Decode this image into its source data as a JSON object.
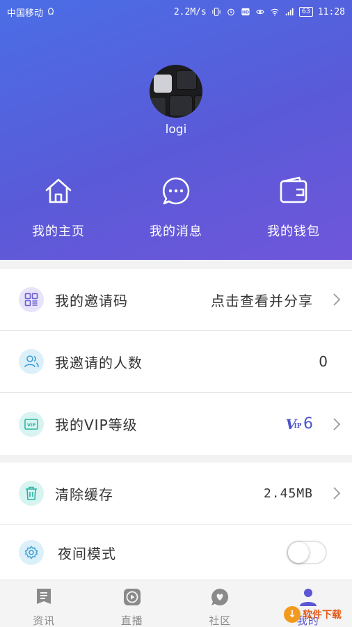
{
  "status_bar": {
    "carrier": "中国移动",
    "speed": "2.2M/s",
    "battery": "63",
    "time": "11:28"
  },
  "profile": {
    "username": "logi"
  },
  "quick_actions": [
    {
      "label": "我的主页",
      "icon": "home-icon"
    },
    {
      "label": "我的消息",
      "icon": "chat-bubble-icon"
    },
    {
      "label": "我的钱包",
      "icon": "wallet-icon"
    }
  ],
  "menu": {
    "invite_code": {
      "title": "我的邀请码",
      "value": "点击查看并分享",
      "icon": "qr-grid-icon",
      "icon_bg": "#e6e3fa",
      "icon_color": "#6a5fd6"
    },
    "invite_count": {
      "title": "我邀请的人数",
      "value": "0",
      "icon": "users-icon",
      "icon_bg": "#dcf0fa",
      "icon_color": "#3c9fd6"
    },
    "vip_level": {
      "title": "我的VIP等级",
      "value": "6",
      "badge": "V",
      "badge_sub": "IP",
      "icon": "vip-card-icon",
      "icon_bg": "#d8f4f1",
      "icon_color": "#24b3a3"
    },
    "clear_cache": {
      "title": "清除缓存",
      "value": "2.45MB",
      "icon": "trash-icon",
      "icon_bg": "#d8f4f1",
      "icon_color": "#24b3a3"
    },
    "night_mode": {
      "title": "夜间模式",
      "icon": "gear-icon",
      "icon_bg": "#dcf0fa",
      "icon_color": "#3c9fd6",
      "enabled": false
    }
  },
  "tabs": [
    {
      "label": "资讯",
      "icon": "news-icon",
      "active": false
    },
    {
      "label": "直播",
      "icon": "play-icon",
      "active": false
    },
    {
      "label": "社区",
      "icon": "heart-bubble-icon",
      "active": false
    },
    {
      "label": "我的",
      "icon": "person-icon",
      "active": true
    }
  ],
  "watermark": {
    "text": "软件下载"
  },
  "colors": {
    "header_gradient_start": "#4a6ee6",
    "header_gradient_end": "#6f56da",
    "accent": "#5b57d6",
    "tab_inactive": "#8a8a8a"
  }
}
